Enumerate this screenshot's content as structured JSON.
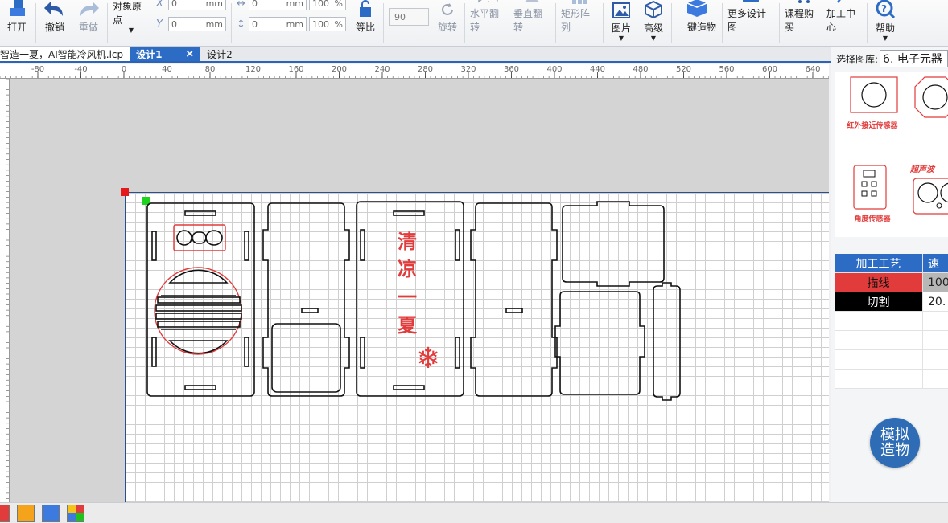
{
  "toolbar": {
    "open": "打开",
    "undo": "撤销",
    "redo": "重做",
    "origin": "对象原点",
    "x_label": "X",
    "y_label": "Y",
    "x_value": "0",
    "y_value": "0",
    "unit": "mm",
    "width_value": "0",
    "height_value": "0",
    "scale_w": "100",
    "scale_h": "100",
    "pct": "%",
    "proportional": "等比",
    "rotate_value": "90",
    "rotate": "旋转",
    "flip_h": "水平翻转",
    "flip_v": "垂直翻转",
    "rect_array": "矩形阵列",
    "image": "图片",
    "advanced": "高级",
    "one_click_build": "一键造物",
    "more_designs": "更多设计图",
    "course_purchase": "课程购买",
    "processing_center": "加工中心",
    "help": "帮助"
  },
  "tabs": [
    {
      "label": "智造一夏，AI智能冷风机.lcp"
    },
    {
      "label": "设计1",
      "close": "×"
    },
    {
      "label": "设计2"
    }
  ],
  "ruler": {
    "h_labels": [
      "-80",
      "-40",
      "0",
      "40",
      "80",
      "120",
      "160",
      "200",
      "240",
      "280",
      "320",
      "360",
      "400",
      "440",
      "480",
      "520",
      "560",
      "600",
      "640"
    ]
  },
  "canvas": {
    "design_text": [
      "清",
      "凉",
      "一",
      "夏"
    ],
    "snowflake": "❄"
  },
  "library": {
    "label": "选择图库:",
    "selected": "6. 电子元器",
    "items": [
      {
        "name": "红外接近传感器"
      },
      {
        "name": ""
      },
      {
        "name": "角度传感器"
      },
      {
        "name": "超声波"
      }
    ]
  },
  "process": {
    "headers": [
      "加工工艺",
      "速"
    ],
    "rows": [
      {
        "name": "描线",
        "value": "100",
        "color": "#e23b3b"
      },
      {
        "name": "切割",
        "value": "20.",
        "color": "#000000"
      }
    ]
  },
  "simulate_button": [
    "模拟",
    "造物"
  ],
  "colors": {
    "accent": "#2d6cc5",
    "line_red": "#e23b3b",
    "swatches": [
      "#e23b3b",
      "#f5a31a",
      "#3c7ae0",
      "multi"
    ]
  }
}
